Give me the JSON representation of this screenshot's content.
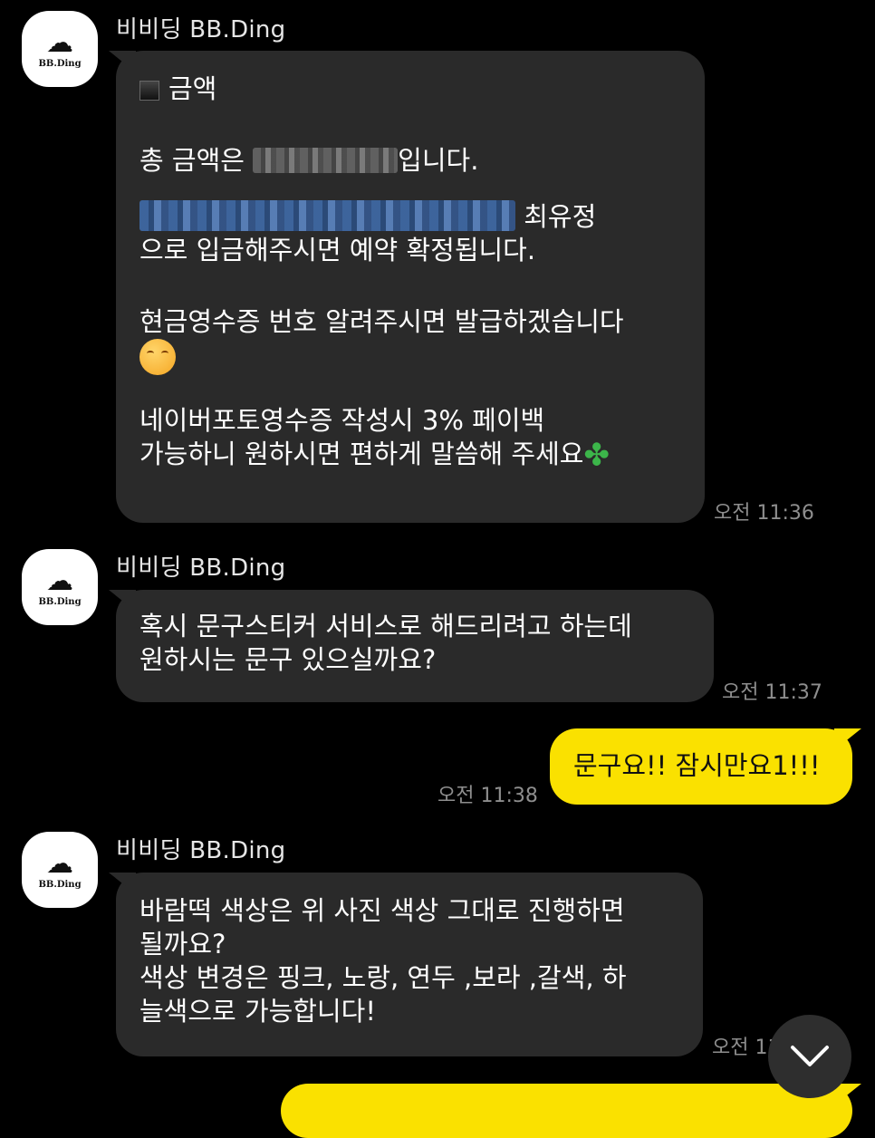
{
  "sender_name": "비비딩 BB.Ding",
  "avatar_brand": "BB.Ding",
  "messages": [
    {
      "heading": "금액",
      "line1_prefix": "총 금액은 ",
      "line1_suffix": "입니다.",
      "line2_suffix": " 최유정",
      "line3": "으로 입금해주시면 예약 확정됩니다.",
      "line4": "현금영수증 번호 알려주시면 발급하겠습니다",
      "line5": "네이버포토영수증 작성시 3% 페이백",
      "line6": "가능하니 원하시면 편하게 말씀해 주세요",
      "time": "오전 11:36"
    },
    {
      "line1": "혹시 문구스티커 서비스로 해드리려고 하는데",
      "line2": "원하시는 문구 있으실까요?",
      "time": "오전 11:37"
    },
    {
      "text": "문구요!! 잠시만요1!!!",
      "time": "오전 11:38"
    },
    {
      "line1": "바람떡 색상은 위 사진 색상 그대로 진행하면",
      "line2": "될까요?",
      "line3": "색상 변경은 핑크, 노랑, 연두 ,보라 ,갈색, 하",
      "line4": "늘색으로 가능합니다!",
      "time": "오전 11"
    }
  ]
}
